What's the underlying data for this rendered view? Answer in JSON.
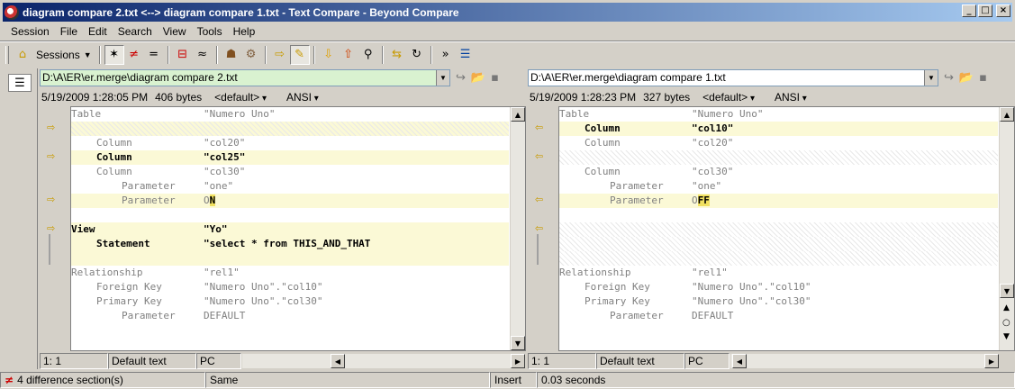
{
  "window": {
    "title": "diagram compare 2.txt <--> diagram compare 1.txt - Text Compare - Beyond Compare",
    "buttons": [
      "_",
      "□",
      "×"
    ]
  },
  "menu": [
    {
      "label": "Session"
    },
    {
      "label": "File"
    },
    {
      "label": "Edit"
    },
    {
      "label": "Search"
    },
    {
      "label": "View"
    },
    {
      "label": "Tools"
    },
    {
      "label": "Help"
    }
  ],
  "toolbar": {
    "sessions_label": "Sessions",
    "icons": [
      "home-icon",
      "show-all-icon",
      "show-differences-icon",
      "show-same-icon",
      "context-icon",
      "minor-icon",
      "rules-icon",
      "format-icon",
      "copy-to-other-side-icon",
      "edit-icon",
      "next-difference-icon",
      "prev-difference-icon",
      "find-icon",
      "swap-sides-icon",
      "reload-icon",
      "next-file-icon",
      "options-icon"
    ]
  },
  "left": {
    "path": "D:\\A\\ER\\er.merge\\diagram compare 2.txt",
    "date": "5/19/2009 1:28:05 PM",
    "size": "406 bytes",
    "format": "<default>",
    "encoding": "ANSI",
    "lines": [
      {
        "indent": 0,
        "key": "Table",
        "value": "\"Numero Uno\"",
        "type": "same"
      },
      {
        "type": "hatch"
      },
      {
        "indent": 1,
        "key": "Column",
        "value": "\"col20\"",
        "type": "same"
      },
      {
        "indent": 1,
        "key": "Column",
        "value": "\"col25\"",
        "type": "diff"
      },
      {
        "indent": 1,
        "key": "Column",
        "value": "\"col30\"",
        "type": "same"
      },
      {
        "indent": 2,
        "key": "Parameter",
        "value": "\"one\"",
        "type": "same"
      },
      {
        "indent": 2,
        "key": "Parameter",
        "value_prefix": "O",
        "value_hl": "N",
        "type": "diff-light"
      },
      {
        "type": "blank"
      },
      {
        "indent": 0,
        "key": "View",
        "value": "\"Yo\"",
        "type": "diff"
      },
      {
        "indent": 1,
        "key": "Statement",
        "value": "\"select * from THIS_AND_THAT",
        "type": "diff"
      },
      {
        "type": "diff-empty"
      },
      {
        "indent": 0,
        "key": "Relationship",
        "value": "\"rel1\"",
        "type": "same"
      },
      {
        "indent": 1,
        "key": "Foreign Key",
        "value": "\"Numero Uno\".\"col10\"",
        "type": "same"
      },
      {
        "indent": 1,
        "key": "Primary Key",
        "value": "\"Numero Uno\".\"col30\"",
        "type": "same"
      },
      {
        "indent": 2,
        "key": "Parameter",
        "value": "DEFAULT",
        "type": "same"
      }
    ],
    "status": {
      "pos": "1: 1",
      "mode": "Default text",
      "eol": "PC"
    }
  },
  "right": {
    "path": "D:\\A\\ER\\er.merge\\diagram compare 1.txt",
    "date": "5/19/2009 1:28:23 PM",
    "size": "327 bytes",
    "format": "<default>",
    "encoding": "ANSI",
    "lines": [
      {
        "indent": 0,
        "key": "Table",
        "value": "\"Numero Uno\"",
        "type": "same"
      },
      {
        "indent": 1,
        "key": "Column",
        "value": "\"col10\"",
        "type": "diff"
      },
      {
        "indent": 1,
        "key": "Column",
        "value": "\"col20\"",
        "type": "same"
      },
      {
        "type": "hatch"
      },
      {
        "indent": 1,
        "key": "Column",
        "value": "\"col30\"",
        "type": "same"
      },
      {
        "indent": 2,
        "key": "Parameter",
        "value": "\"one\"",
        "type": "same"
      },
      {
        "indent": 2,
        "key": "Parameter",
        "value_prefix": "O",
        "value_hl": "FF",
        "type": "diff-light"
      },
      {
        "type": "blank"
      },
      {
        "type": "hatch"
      },
      {
        "type": "hatch"
      },
      {
        "type": "hatch"
      },
      {
        "indent": 0,
        "key": "Relationship",
        "value": "\"rel1\"",
        "type": "same"
      },
      {
        "indent": 1,
        "key": "Foreign Key",
        "value": "\"Numero Uno\".\"col10\"",
        "type": "same"
      },
      {
        "indent": 1,
        "key": "Primary Key",
        "value": "\"Numero Uno\".\"col30\"",
        "type": "same"
      },
      {
        "indent": 2,
        "key": "Parameter",
        "value": "DEFAULT",
        "type": "same"
      }
    ],
    "status": {
      "pos": "1: 1",
      "mode": "Default text",
      "eol": "PC"
    }
  },
  "statusbar": {
    "differences": "4 difference section(s)",
    "comparison": "Same",
    "insert_mode": "Insert",
    "time": "0.03 seconds"
  },
  "colors": {
    "diff_bg": "#fbf9d6",
    "highlight": "#f0e060",
    "left_path_bg": "#d9f2d0"
  }
}
